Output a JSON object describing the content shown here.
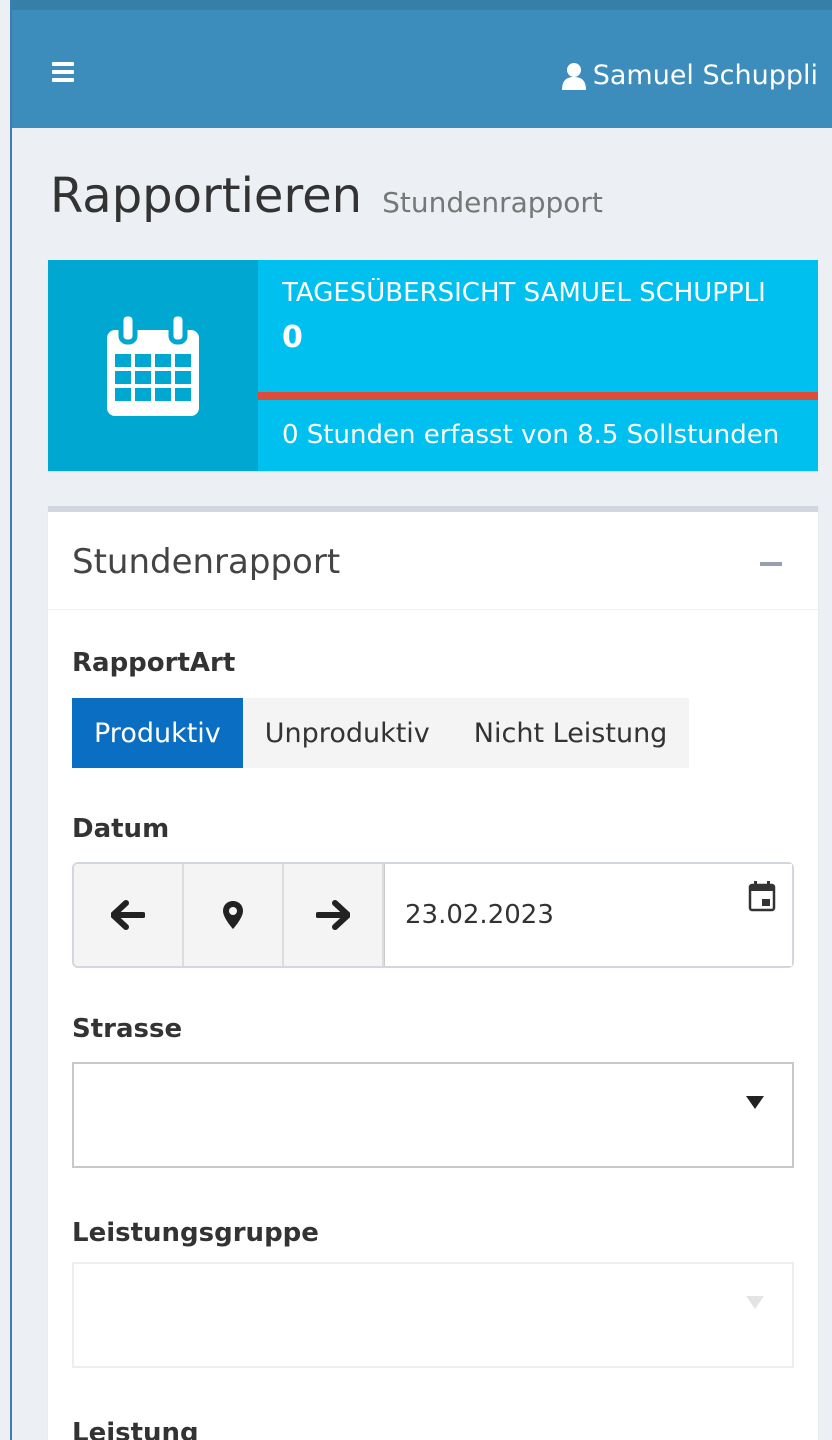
{
  "header": {
    "user_name": "Samuel Schuppli"
  },
  "page": {
    "title": "Rapportieren",
    "subtitle": "Stundenrapport"
  },
  "infobox": {
    "title": "TAGESÜBERSICHT SAMUEL SCHUPPLI",
    "number": "0",
    "description": "0 Stunden erfasst von 8.5 Sollstunden",
    "progress_fraction": 0
  },
  "form": {
    "box_title": "Stundenrapport",
    "rapportart": {
      "label": "RapportArt",
      "options": [
        "Produktiv",
        "Unproduktiv",
        "Nicht Leistung"
      ],
      "selected": "Produktiv"
    },
    "datum": {
      "label": "Datum",
      "value": "23.02.2023"
    },
    "strasse": {
      "label": "Strasse",
      "value": ""
    },
    "leistungsgruppe": {
      "label": "Leistungsgruppe",
      "value": ""
    },
    "leistung": {
      "label": "Leistung"
    }
  },
  "colors": {
    "header": "#3c8dbc",
    "infobox": "#00c0ef",
    "infobox_icon_bg": "#00a7d0",
    "progress": "#dd4b39",
    "active_segment": "#0a6fc2"
  },
  "icons": {
    "menu": "hamburger-icon",
    "user": "user-icon",
    "infobox": "calendar-icon",
    "prev": "arrow-left-icon",
    "location": "map-marker-icon",
    "next": "arrow-right-icon",
    "datepicker": "calendar-small-icon"
  }
}
